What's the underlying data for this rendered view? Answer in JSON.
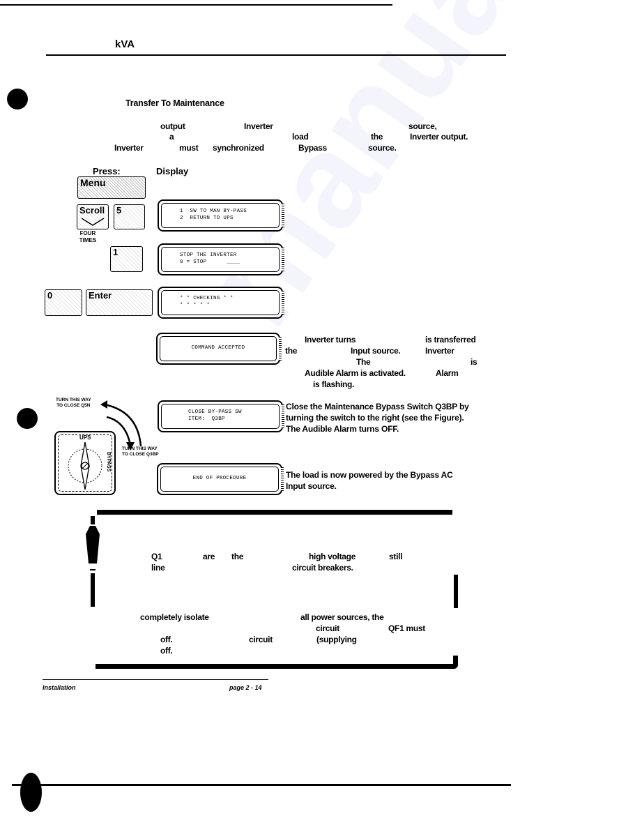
{
  "header": {
    "unit_label": "kVA"
  },
  "section": {
    "title": "Transfer To Maintenance",
    "intro_fragments": {
      "line1": [
        "output",
        "Inverter",
        "source,"
      ],
      "line2": [
        "a",
        "load",
        "the",
        "Inverter output."
      ],
      "line3": [
        "Inverter",
        "must",
        "synchronized",
        "Bypass",
        "source."
      ]
    }
  },
  "columns": {
    "press": "Press:",
    "display": "Display"
  },
  "steps": [
    {
      "keys": [
        "Menu"
      ],
      "display_lines": [],
      "description": []
    },
    {
      "keys": [
        "Scroll",
        "5"
      ],
      "key_caption": "FOUR\nTIMES",
      "display_lines": [
        "1  SW TO MAN BY-PASS",
        "2  RETURN TO UPS"
      ],
      "description": []
    },
    {
      "keys": [
        "1"
      ],
      "display_lines": [
        "STOP THE INVERTER",
        "0 = STOP      ____"
      ],
      "description": []
    },
    {
      "keys": [
        "0",
        "Enter"
      ],
      "display_lines": [
        "* * CHECKING * *",
        "* * * * *"
      ],
      "description": []
    },
    {
      "keys": [],
      "display_lines": [
        "COMMAND ACCEPTED"
      ],
      "description_fragments": [
        "Inverter turns",
        "is transferred",
        "the",
        "Input source.",
        "Inverter",
        "The",
        "is",
        "Audible Alarm is activated.",
        "Alarm",
        "is flashing."
      ]
    },
    {
      "keys": [],
      "display_lines": [
        "CLOSE BY-PASS SW",
        "ITEM:  Q3BP"
      ],
      "description": [
        "Close the Maintenance Bypass Switch Q3BP by",
        "turning the switch to the right (see the Figure).",
        "The Audible Alarm turns OFF."
      ]
    },
    {
      "keys": [],
      "display_lines": [
        "END OF PROCEDURE"
      ],
      "description": [
        "The load is now powered by the Bypass AC",
        "Input source."
      ]
    }
  ],
  "switch_figure": {
    "label_top": "UPS",
    "label_side": "BYPASS",
    "arrow_up_caption": "TURN THIS WAY\nTO CLOSE Q5N",
    "arrow_down_caption": "TURN THIS WAY\nTO CLOSE Q3BP"
  },
  "caution": {
    "line1": [
      "Q1",
      "are",
      "the",
      "high voltage",
      "still"
    ],
    "line2": [
      "line",
      "circuit breakers."
    ],
    "line3": [
      "completely isolate",
      "all power sources, the"
    ],
    "line4": [
      "circuit",
      "QF1 must"
    ],
    "line5": [
      "off.",
      "circuit",
      "(supplying"
    ],
    "line6": [
      "off."
    ]
  },
  "footer": {
    "section": "Installation",
    "page": "page 2 - 14"
  },
  "watermark": "manualslib"
}
